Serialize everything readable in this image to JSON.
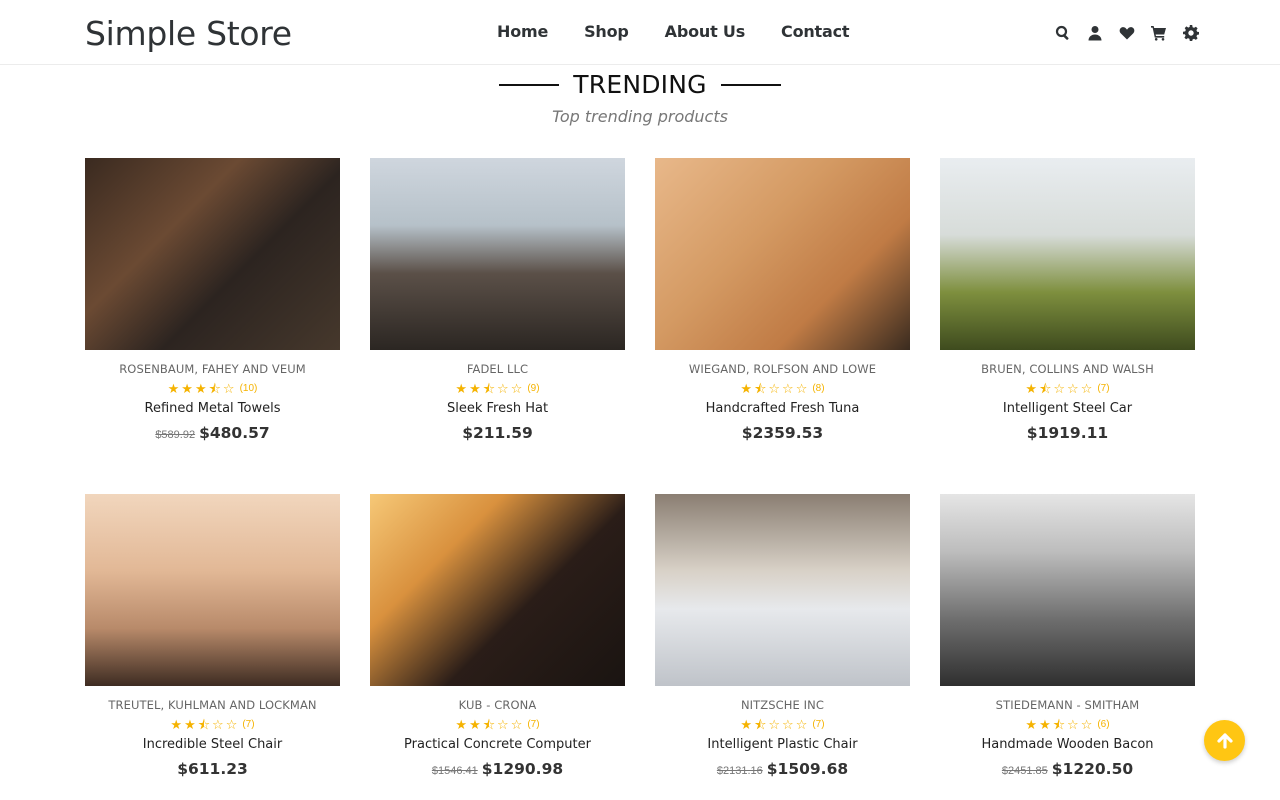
{
  "header": {
    "logo": "Simple Store",
    "nav": [
      {
        "label": "Home"
      },
      {
        "label": "Shop"
      },
      {
        "label": "About Us"
      },
      {
        "label": "Contact"
      }
    ],
    "icons": [
      "search-icon",
      "user-icon",
      "heart-icon",
      "cart-icon",
      "gear-icon"
    ]
  },
  "section": {
    "title": "TRENDING",
    "subtitle": "Top trending products"
  },
  "products": [
    {
      "vendor": "ROSENBAUM, FAHEY AND VEUM",
      "rating": 3.5,
      "reviews": "(10)",
      "name": "Refined Metal Towels",
      "old_price": "$589.92",
      "price": "$480.57"
    },
    {
      "vendor": "FADEL LLC",
      "rating": 2.5,
      "reviews": "(9)",
      "name": "Sleek Fresh Hat",
      "old_price": "",
      "price": "$211.59"
    },
    {
      "vendor": "WIEGAND, ROLFSON AND LOWE",
      "rating": 1.5,
      "reviews": "(8)",
      "name": "Handcrafted Fresh Tuna",
      "old_price": "",
      "price": "$2359.53"
    },
    {
      "vendor": "BRUEN, COLLINS AND WALSH",
      "rating": 1.5,
      "reviews": "(7)",
      "name": "Intelligent Steel Car",
      "old_price": "",
      "price": "$1919.11"
    },
    {
      "vendor": "TREUTEL, KUHLMAN AND LOCKMAN",
      "rating": 2.5,
      "reviews": "(7)",
      "name": "Incredible Steel Chair",
      "old_price": "",
      "price": "$611.23"
    },
    {
      "vendor": "KUB - CRONA",
      "rating": 2.5,
      "reviews": "(7)",
      "name": "Practical Concrete Computer",
      "old_price": "$1546.41",
      "price": "$1290.98"
    },
    {
      "vendor": "NITZSCHE INC",
      "rating": 1.5,
      "reviews": "(7)",
      "name": "Intelligent Plastic Chair",
      "old_price": "$2131.16",
      "price": "$1509.68"
    },
    {
      "vendor": "STIEDEMANN - SMITHAM",
      "rating": 2.5,
      "reviews": "(6)",
      "name": "Handmade Wooden Bacon",
      "old_price": "$2451.85",
      "price": "$1220.50"
    }
  ],
  "colors": {
    "accent": "#ffc613",
    "star": "#f5b301",
    "text_dark": "#2f3336"
  },
  "scroll_top": {
    "icon": "arrow-up-icon"
  }
}
